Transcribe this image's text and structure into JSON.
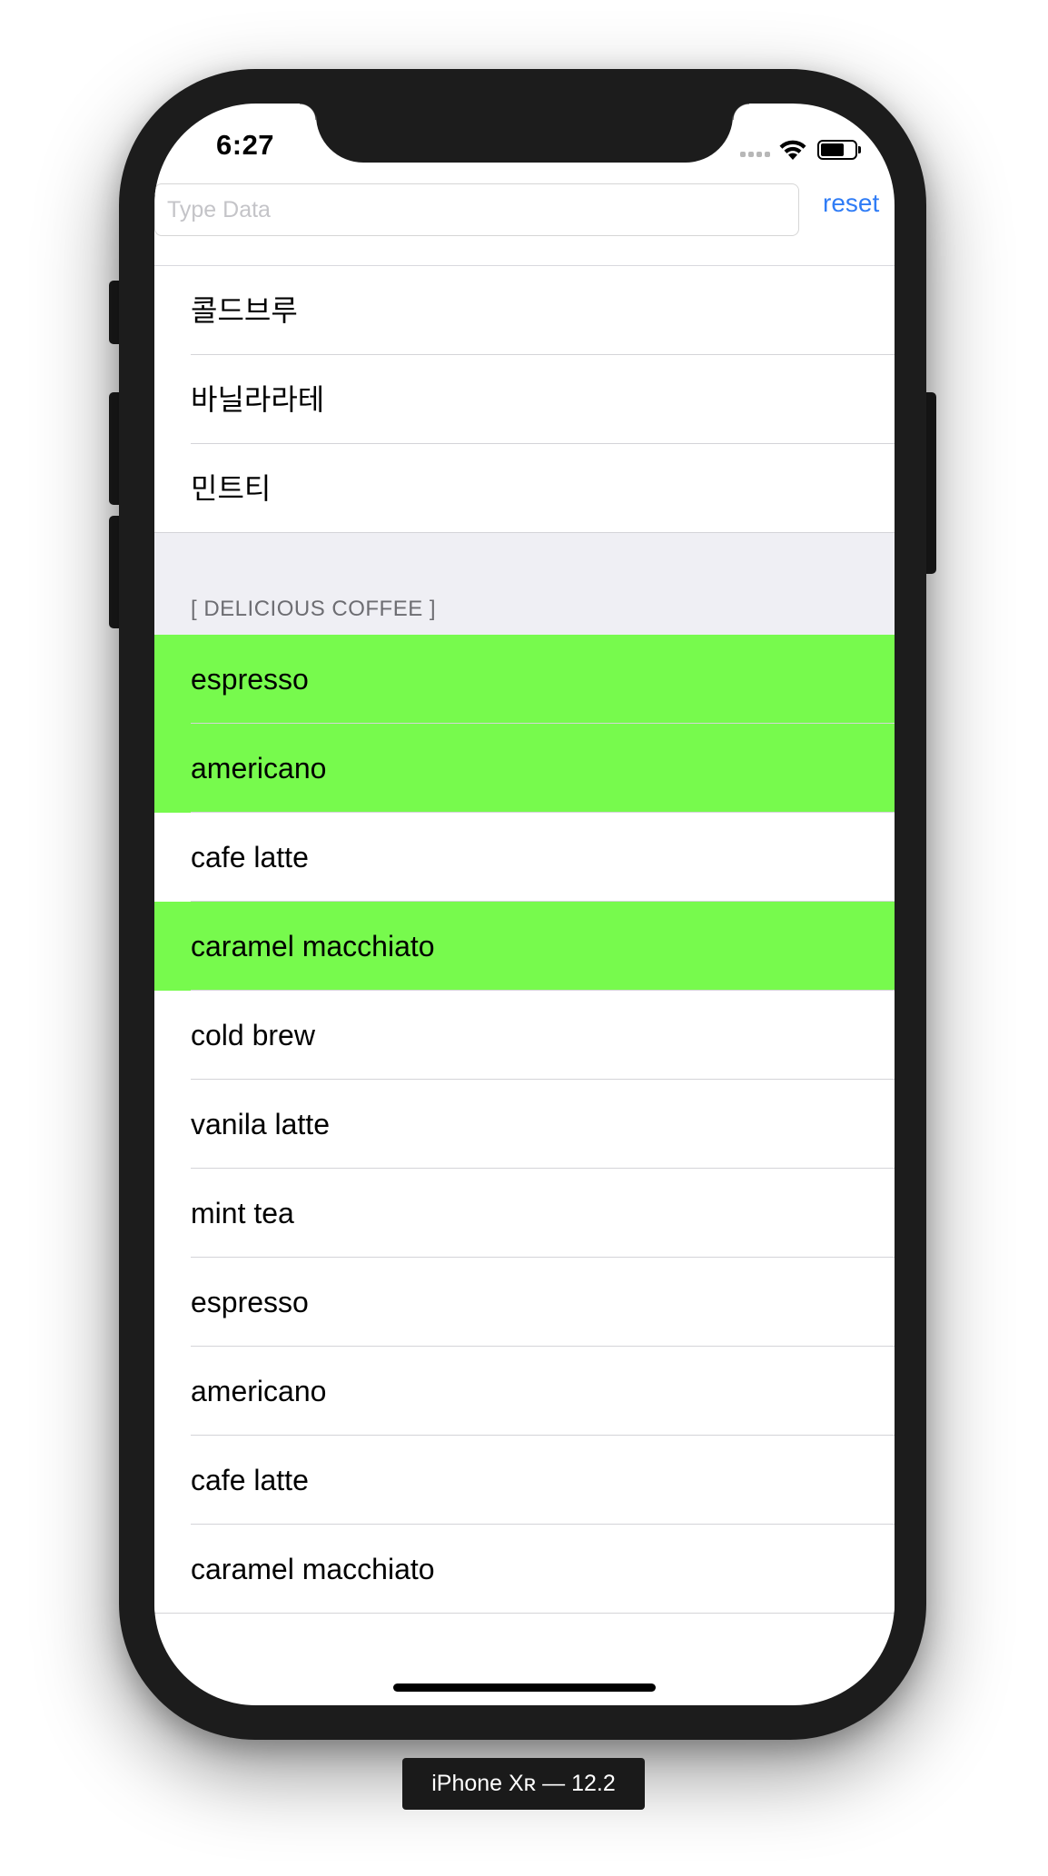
{
  "status_bar": {
    "time": "6:27"
  },
  "search": {
    "placeholder": "Type Data",
    "value": "",
    "reset_label": "reset"
  },
  "table": {
    "section1_rows": [
      {
        "label": "콜드브루",
        "highlighted": false
      },
      {
        "label": "바닐라라테",
        "highlighted": false
      },
      {
        "label": "민트티",
        "highlighted": false
      }
    ],
    "section2_header": "[ DELICIOUS COFFEE ]",
    "section2_rows": [
      {
        "label": "espresso",
        "highlighted": true
      },
      {
        "label": "americano",
        "highlighted": true
      },
      {
        "label": "cafe latte",
        "highlighted": false
      },
      {
        "label": "caramel macchiato",
        "highlighted": true
      },
      {
        "label": "cold brew",
        "highlighted": false
      },
      {
        "label": "vanila latte",
        "highlighted": false
      },
      {
        "label": "mint tea",
        "highlighted": false
      },
      {
        "label": "espresso",
        "highlighted": false
      },
      {
        "label": "americano",
        "highlighted": false
      },
      {
        "label": "cafe latte",
        "highlighted": false
      },
      {
        "label": "caramel macchiato",
        "highlighted": false
      }
    ]
  },
  "colors": {
    "highlight": "#77fa4d",
    "accent": "#2f7cf6",
    "section_header_bg": "#efeff4"
  },
  "simulator_label": "iPhone Xʀ — 12.2"
}
